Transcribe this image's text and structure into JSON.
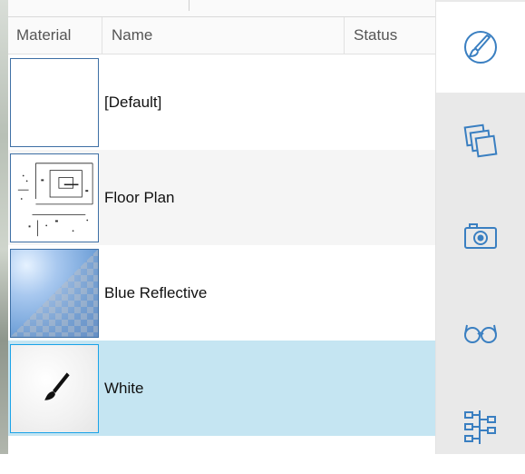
{
  "table": {
    "headers": {
      "material": "Material",
      "name": "Name",
      "status": "Status"
    },
    "rows": [
      {
        "name": "[Default]",
        "status": ""
      },
      {
        "name": "Floor Plan",
        "status": ""
      },
      {
        "name": "Blue Reflective",
        "status": ""
      },
      {
        "name": "White",
        "status": ""
      }
    ],
    "selected_row": "White"
  },
  "sidebar": {
    "buttons": [
      {
        "icon": "paint-brush-icon",
        "active": true
      },
      {
        "icon": "layers-icon",
        "active": false
      },
      {
        "icon": "camera-icon",
        "active": false
      },
      {
        "icon": "glasses-icon",
        "active": false
      },
      {
        "icon": "hierarchy-icon",
        "active": false
      }
    ]
  },
  "colors": {
    "accent": "#3a7fc1",
    "selected_row": "#c5e5f2",
    "sidebar_bg": "#e9e9e9"
  }
}
